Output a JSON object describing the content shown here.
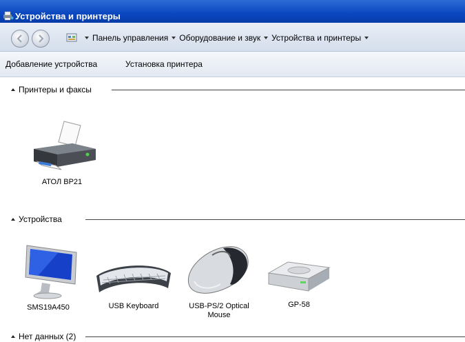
{
  "window": {
    "title": "Устройства и принтеры"
  },
  "breadcrumbs": [
    "Панель управления",
    "Оборудование и звук",
    "Устройства и принтеры"
  ],
  "toolbar": {
    "add_device": "Добавление устройства",
    "install_printer": "Установка принтера"
  },
  "groups": {
    "printers": {
      "header": "Принтеры и факсы",
      "items": [
        {
          "name": "АТОЛ BP21",
          "icon": "printer-icon"
        }
      ]
    },
    "devices": {
      "header": "Устройства",
      "items": [
        {
          "name": "SMS19A450",
          "icon": "monitor-icon"
        },
        {
          "name": "USB Keyboard",
          "icon": "keyboard-icon"
        },
        {
          "name": "USB-PS/2 Optical Mouse",
          "icon": "mouse-icon"
        },
        {
          "name": "GP-58",
          "icon": "drive-icon"
        }
      ]
    },
    "unspecified": {
      "header": "Нет данных (2)"
    }
  },
  "colors": {
    "titlebar": "#0a47c0",
    "toolbar": "#e3e9f2",
    "address_bar": "#d5deec"
  }
}
